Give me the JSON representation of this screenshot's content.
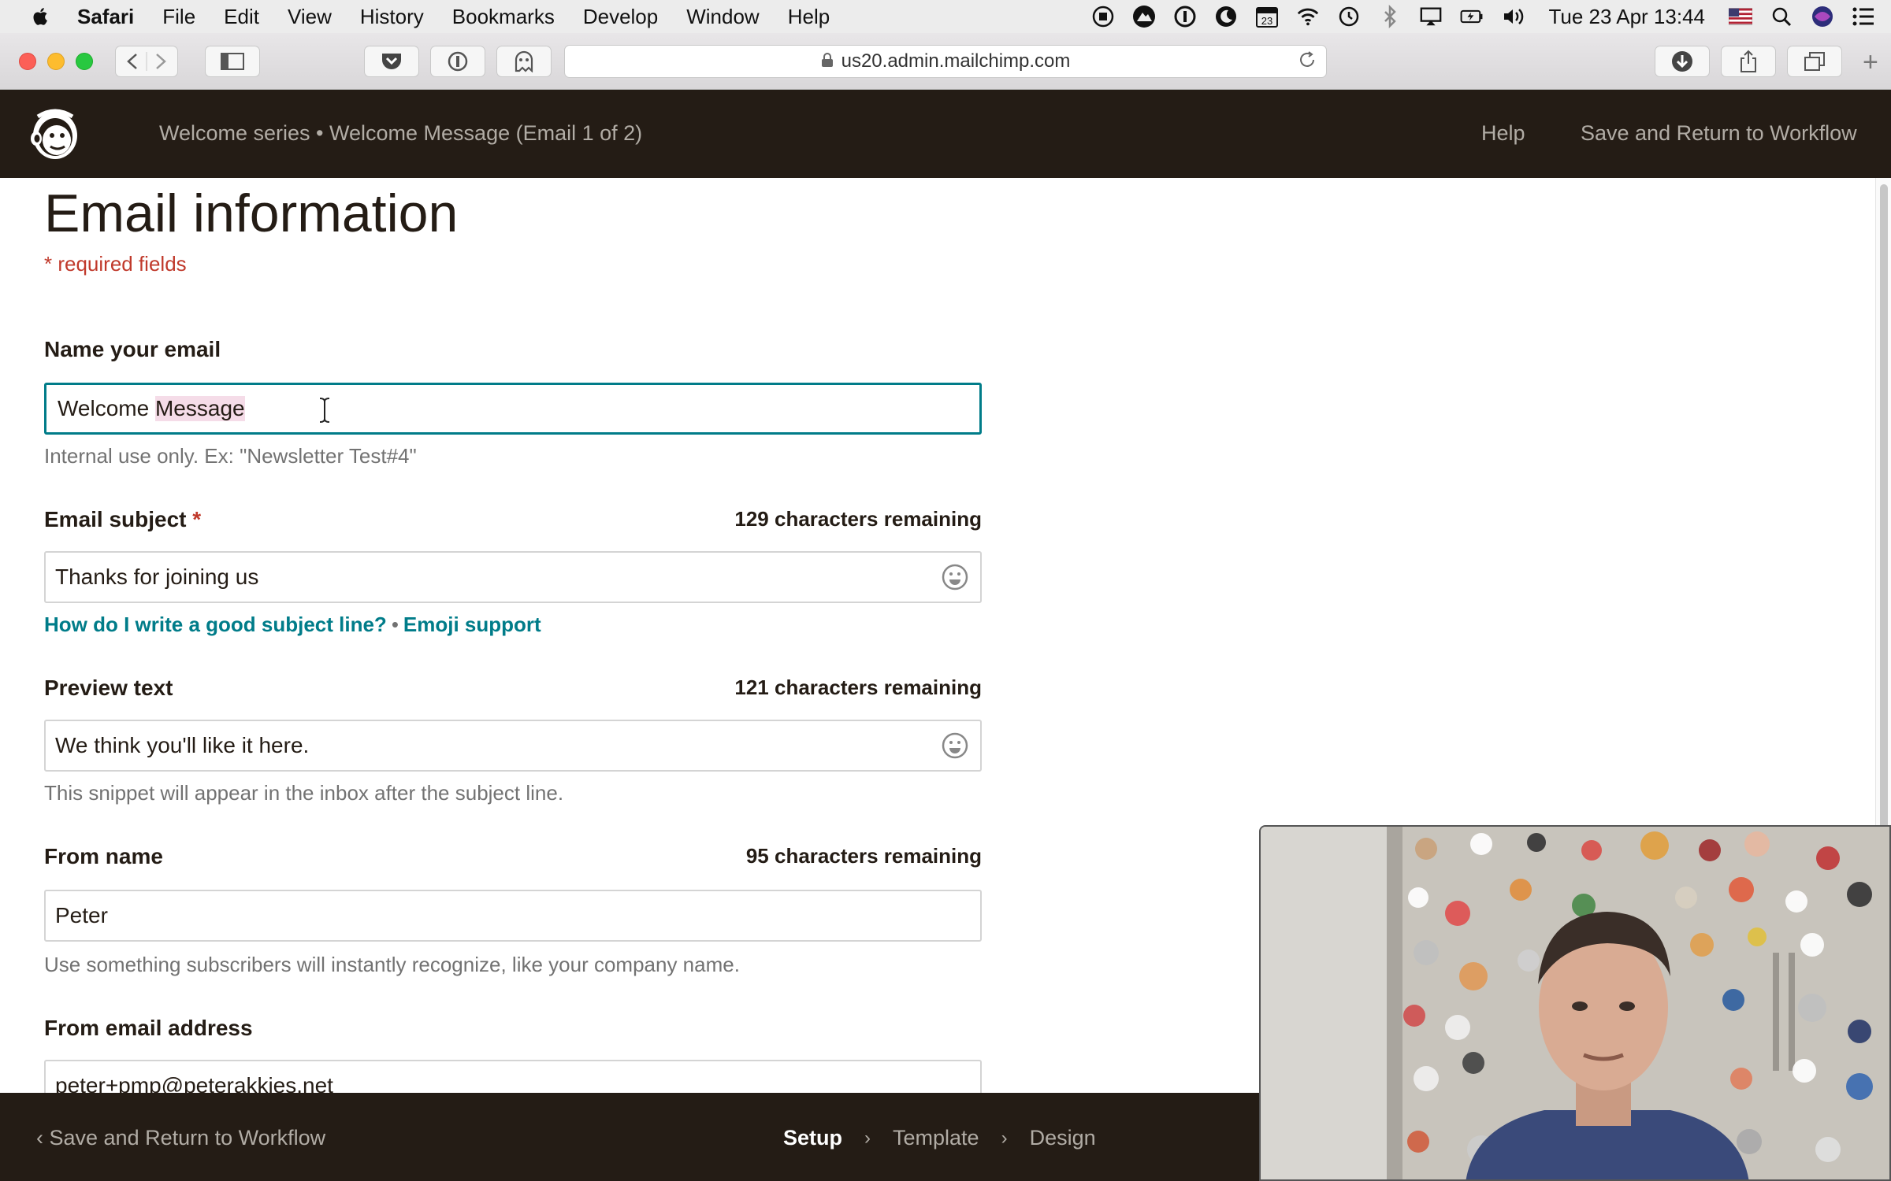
{
  "menubar": {
    "items": [
      "Safari",
      "File",
      "Edit",
      "View",
      "History",
      "Bookmarks",
      "Develop",
      "Window",
      "Help"
    ],
    "calendar_day": "23",
    "clock": "Tue 23 Apr  13:44"
  },
  "browser": {
    "url": "us20.admin.mailchimp.com"
  },
  "header": {
    "breadcrumb": "Welcome series • Welcome Message (Email 1 of 2)",
    "help": "Help",
    "save_return": "Save and Return to Workflow"
  },
  "form": {
    "title": "Email information",
    "required_note": "* required fields",
    "name": {
      "label": "Name your email",
      "value_prefix": "Welcome ",
      "value_highlighted": "Message",
      "helper": "Internal use only. Ex: \"Newsletter Test#4\""
    },
    "subject": {
      "label": "Email subject",
      "required_mark": "*",
      "remaining": "129 characters remaining",
      "value": "Thanks for joining us",
      "link_guide": "How do I write a good subject line?",
      "link_sep": "•",
      "link_emoji": "Emoji support"
    },
    "preview": {
      "label": "Preview text",
      "remaining": "121 characters remaining",
      "value": "We think you'll like it here.",
      "helper": "This snippet will appear in the inbox after the subject line."
    },
    "from_name": {
      "label": "From name",
      "remaining": "95 characters remaining",
      "value": "Peter",
      "helper": "Use something subscribers will instantly recognize, like your company name."
    },
    "from_email": {
      "label": "From email address",
      "value": "peter+pmp@peterakkies.net"
    }
  },
  "footer": {
    "back": "Save and Return to Workflow",
    "steps": [
      "Setup",
      "Template",
      "Design"
    ],
    "active_step": "Setup"
  },
  "colors": {
    "brand_dark": "#241c15",
    "link_teal": "#007c89",
    "required_red": "#c0392b"
  }
}
